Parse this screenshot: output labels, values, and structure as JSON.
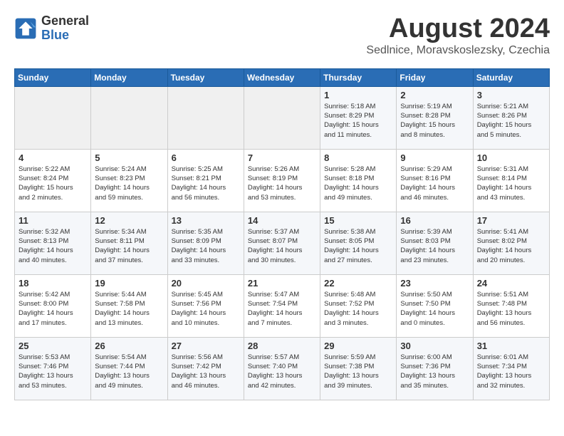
{
  "header": {
    "logo_general": "General",
    "logo_blue": "Blue",
    "title": "August 2024",
    "subtitle": "Sedlnice, Moravskoslezsky, Czechia"
  },
  "weekdays": [
    "Sunday",
    "Monday",
    "Tuesday",
    "Wednesday",
    "Thursday",
    "Friday",
    "Saturday"
  ],
  "weeks": [
    [
      {
        "day": "",
        "info": ""
      },
      {
        "day": "",
        "info": ""
      },
      {
        "day": "",
        "info": ""
      },
      {
        "day": "",
        "info": ""
      },
      {
        "day": "1",
        "info": "Sunrise: 5:18 AM\nSunset: 8:29 PM\nDaylight: 15 hours\nand 11 minutes."
      },
      {
        "day": "2",
        "info": "Sunrise: 5:19 AM\nSunset: 8:28 PM\nDaylight: 15 hours\nand 8 minutes."
      },
      {
        "day": "3",
        "info": "Sunrise: 5:21 AM\nSunset: 8:26 PM\nDaylight: 15 hours\nand 5 minutes."
      }
    ],
    [
      {
        "day": "4",
        "info": "Sunrise: 5:22 AM\nSunset: 8:24 PM\nDaylight: 15 hours\nand 2 minutes."
      },
      {
        "day": "5",
        "info": "Sunrise: 5:24 AM\nSunset: 8:23 PM\nDaylight: 14 hours\nand 59 minutes."
      },
      {
        "day": "6",
        "info": "Sunrise: 5:25 AM\nSunset: 8:21 PM\nDaylight: 14 hours\nand 56 minutes."
      },
      {
        "day": "7",
        "info": "Sunrise: 5:26 AM\nSunset: 8:19 PM\nDaylight: 14 hours\nand 53 minutes."
      },
      {
        "day": "8",
        "info": "Sunrise: 5:28 AM\nSunset: 8:18 PM\nDaylight: 14 hours\nand 49 minutes."
      },
      {
        "day": "9",
        "info": "Sunrise: 5:29 AM\nSunset: 8:16 PM\nDaylight: 14 hours\nand 46 minutes."
      },
      {
        "day": "10",
        "info": "Sunrise: 5:31 AM\nSunset: 8:14 PM\nDaylight: 14 hours\nand 43 minutes."
      }
    ],
    [
      {
        "day": "11",
        "info": "Sunrise: 5:32 AM\nSunset: 8:13 PM\nDaylight: 14 hours\nand 40 minutes."
      },
      {
        "day": "12",
        "info": "Sunrise: 5:34 AM\nSunset: 8:11 PM\nDaylight: 14 hours\nand 37 minutes."
      },
      {
        "day": "13",
        "info": "Sunrise: 5:35 AM\nSunset: 8:09 PM\nDaylight: 14 hours\nand 33 minutes."
      },
      {
        "day": "14",
        "info": "Sunrise: 5:37 AM\nSunset: 8:07 PM\nDaylight: 14 hours\nand 30 minutes."
      },
      {
        "day": "15",
        "info": "Sunrise: 5:38 AM\nSunset: 8:05 PM\nDaylight: 14 hours\nand 27 minutes."
      },
      {
        "day": "16",
        "info": "Sunrise: 5:39 AM\nSunset: 8:03 PM\nDaylight: 14 hours\nand 23 minutes."
      },
      {
        "day": "17",
        "info": "Sunrise: 5:41 AM\nSunset: 8:02 PM\nDaylight: 14 hours\nand 20 minutes."
      }
    ],
    [
      {
        "day": "18",
        "info": "Sunrise: 5:42 AM\nSunset: 8:00 PM\nDaylight: 14 hours\nand 17 minutes."
      },
      {
        "day": "19",
        "info": "Sunrise: 5:44 AM\nSunset: 7:58 PM\nDaylight: 14 hours\nand 13 minutes."
      },
      {
        "day": "20",
        "info": "Sunrise: 5:45 AM\nSunset: 7:56 PM\nDaylight: 14 hours\nand 10 minutes."
      },
      {
        "day": "21",
        "info": "Sunrise: 5:47 AM\nSunset: 7:54 PM\nDaylight: 14 hours\nand 7 minutes."
      },
      {
        "day": "22",
        "info": "Sunrise: 5:48 AM\nSunset: 7:52 PM\nDaylight: 14 hours\nand 3 minutes."
      },
      {
        "day": "23",
        "info": "Sunrise: 5:50 AM\nSunset: 7:50 PM\nDaylight: 14 hours\nand 0 minutes."
      },
      {
        "day": "24",
        "info": "Sunrise: 5:51 AM\nSunset: 7:48 PM\nDaylight: 13 hours\nand 56 minutes."
      }
    ],
    [
      {
        "day": "25",
        "info": "Sunrise: 5:53 AM\nSunset: 7:46 PM\nDaylight: 13 hours\nand 53 minutes."
      },
      {
        "day": "26",
        "info": "Sunrise: 5:54 AM\nSunset: 7:44 PM\nDaylight: 13 hours\nand 49 minutes."
      },
      {
        "day": "27",
        "info": "Sunrise: 5:56 AM\nSunset: 7:42 PM\nDaylight: 13 hours\nand 46 minutes."
      },
      {
        "day": "28",
        "info": "Sunrise: 5:57 AM\nSunset: 7:40 PM\nDaylight: 13 hours\nand 42 minutes."
      },
      {
        "day": "29",
        "info": "Sunrise: 5:59 AM\nSunset: 7:38 PM\nDaylight: 13 hours\nand 39 minutes."
      },
      {
        "day": "30",
        "info": "Sunrise: 6:00 AM\nSunset: 7:36 PM\nDaylight: 13 hours\nand 35 minutes."
      },
      {
        "day": "31",
        "info": "Sunrise: 6:01 AM\nSunset: 7:34 PM\nDaylight: 13 hours\nand 32 minutes."
      }
    ]
  ]
}
